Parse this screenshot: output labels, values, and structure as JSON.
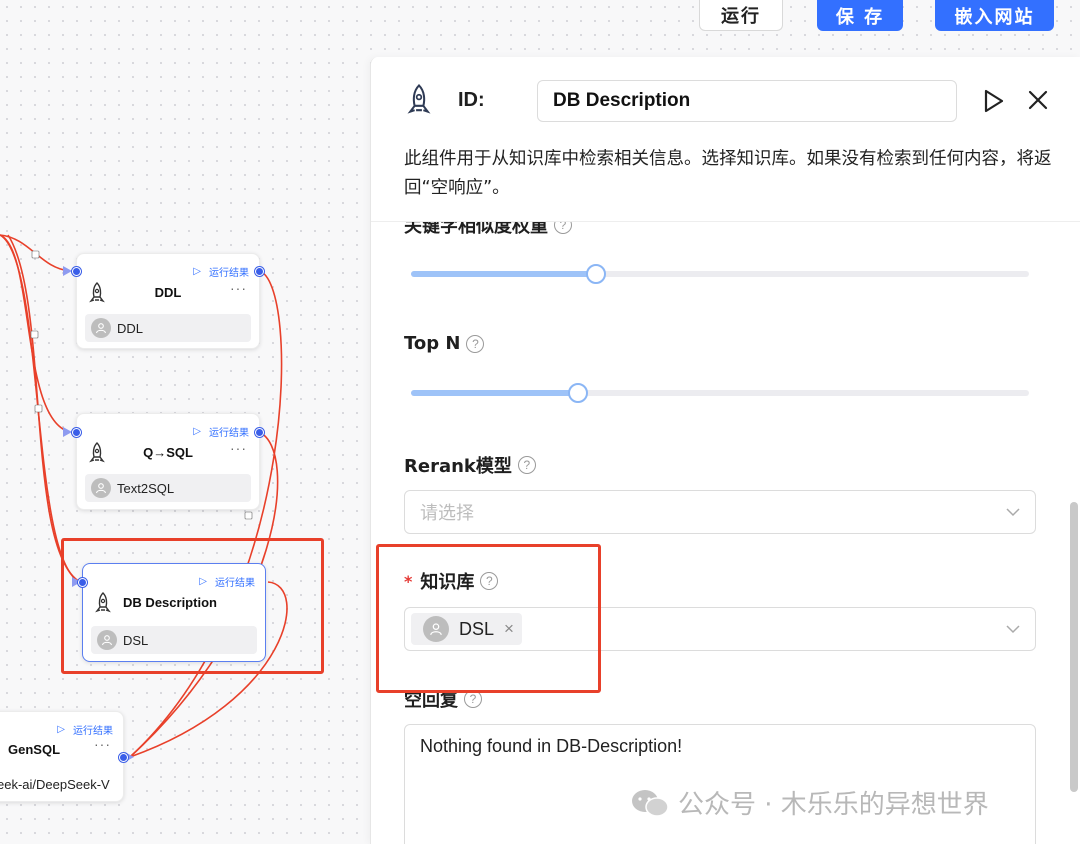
{
  "toolbar": {
    "run": "运行",
    "save": "保 存",
    "embed": "嵌入网站"
  },
  "nodes": [
    {
      "title": "DDL",
      "run_result": "运行结果",
      "chip": "DDL",
      "icon": "rocket-icon"
    },
    {
      "title": "Q→SQL",
      "run_result": "运行结果",
      "chip": "Text2SQL",
      "icon": "rocket-icon"
    },
    {
      "title": "DB Description",
      "run_result": "运行结果",
      "chip": "DSL",
      "icon": "rocket-icon"
    },
    {
      "title": "GenSQL",
      "run_result": "运行结果",
      "chip": "eek-ai/DeepSeek-V"
    }
  ],
  "panel": {
    "id_label": "ID:",
    "name_value": "DB Description",
    "description": "此组件用于从知识库中检索相关信息。选择知识库。如果没有检索到任何内容，将返回“空响应”。",
    "keyword_weight": {
      "label": "关键字相似度权重",
      "value_fraction": 0.3
    },
    "top_n": {
      "label": "Top N",
      "value_fraction": 0.27
    },
    "rerank": {
      "label": "Rerank模型",
      "placeholder": "请选择"
    },
    "knowledge_base": {
      "required_mark": "*",
      "label": "知识库",
      "selected": "DSL"
    },
    "empty_response": {
      "label": "空回复",
      "value": "Nothing found in DB-Description!"
    },
    "help_glyph": "?"
  },
  "watermark": "公众号 · 木乐乐的异想世界",
  "colors": {
    "accent": "#3370ff",
    "highlight": "#e8402a",
    "wire": "#e8402a"
  }
}
